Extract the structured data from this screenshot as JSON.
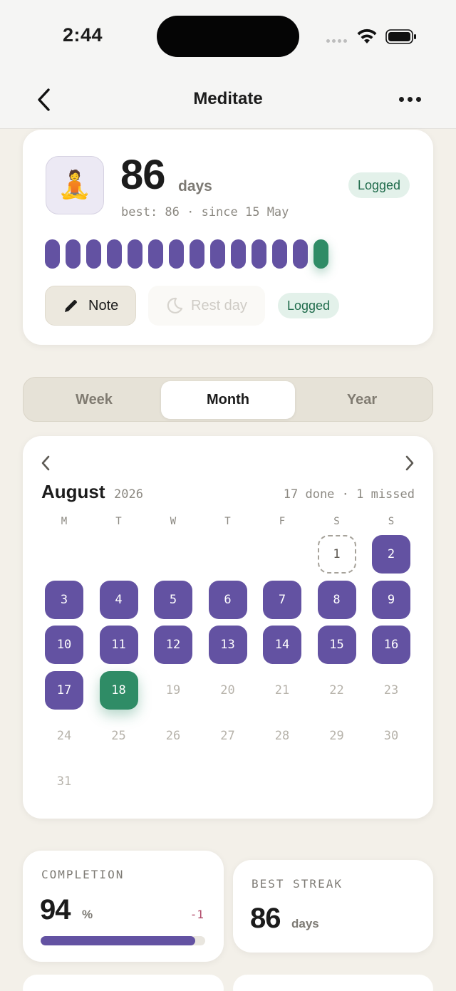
{
  "status_bar": {
    "time": "2:44"
  },
  "nav": {
    "title": "Meditate"
  },
  "habit": {
    "emoji": "🧘",
    "streak": "86",
    "streak_unit": "days",
    "best_line": "best: 86 · since 15 May",
    "status": "Logged",
    "recent_pips": [
      "done",
      "done",
      "done",
      "done",
      "done",
      "done",
      "done",
      "done",
      "done",
      "done",
      "done",
      "done",
      "done",
      "today"
    ],
    "note_label": "Note",
    "rest_label": "Rest day",
    "rest_status": "Logged"
  },
  "tabs": [
    {
      "label": "Week"
    },
    {
      "label": "Month",
      "active": true
    },
    {
      "label": "Year"
    }
  ],
  "calendar": {
    "month": "August",
    "year": "2026",
    "summary": "17 done · 1 missed",
    "weekdays": [
      "M",
      "T",
      "W",
      "T",
      "F",
      "S",
      "S"
    ],
    "first_weekday_index": 5,
    "days": [
      {
        "d": "1",
        "s": "missed"
      },
      {
        "d": "2",
        "s": "done"
      },
      {
        "d": "3",
        "s": "done"
      },
      {
        "d": "4",
        "s": "done"
      },
      {
        "d": "5",
        "s": "done"
      },
      {
        "d": "6",
        "s": "done"
      },
      {
        "d": "7",
        "s": "done"
      },
      {
        "d": "8",
        "s": "done"
      },
      {
        "d": "9",
        "s": "done"
      },
      {
        "d": "10",
        "s": "done"
      },
      {
        "d": "11",
        "s": "done"
      },
      {
        "d": "12",
        "s": "done"
      },
      {
        "d": "13",
        "s": "done"
      },
      {
        "d": "14",
        "s": "done"
      },
      {
        "d": "15",
        "s": "done"
      },
      {
        "d": "16",
        "s": "done"
      },
      {
        "d": "17",
        "s": "done"
      },
      {
        "d": "18",
        "s": "today"
      },
      {
        "d": "19",
        "s": "future"
      },
      {
        "d": "20",
        "s": "future"
      },
      {
        "d": "21",
        "s": "future"
      },
      {
        "d": "22",
        "s": "future"
      },
      {
        "d": "23",
        "s": "future"
      },
      {
        "d": "24",
        "s": "future"
      },
      {
        "d": "25",
        "s": "future"
      },
      {
        "d": "26",
        "s": "future"
      },
      {
        "d": "27",
        "s": "future"
      },
      {
        "d": "28",
        "s": "future"
      },
      {
        "d": "29",
        "s": "future"
      },
      {
        "d": "30",
        "s": "future"
      },
      {
        "d": "31",
        "s": "future"
      }
    ]
  },
  "stats": {
    "completion": {
      "label": "COMPLETION",
      "value": "94",
      "unit": "%",
      "delta": "-1",
      "fraction": 0.94
    },
    "best_streak": {
      "label": "BEST STREAK",
      "value": "86",
      "unit": "days"
    }
  },
  "colors": {
    "accent": "#6352a2",
    "today": "#2f8c66",
    "background": "#f3f0e9"
  }
}
